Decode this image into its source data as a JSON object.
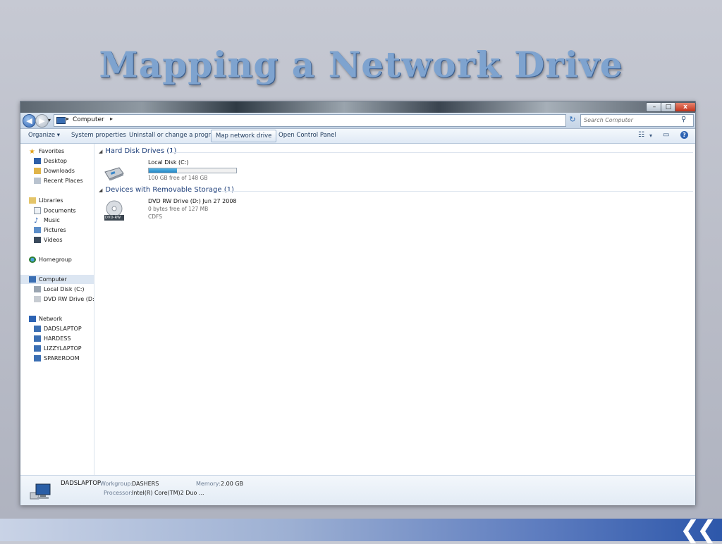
{
  "slide": {
    "title": "Mapping a Network Drive"
  },
  "window": {
    "controls": {
      "minimize": "–",
      "maximize": "□",
      "close": "x"
    }
  },
  "address": {
    "breadcrumb": "Computer",
    "search_placeholder": "Search Computer"
  },
  "toolbar": {
    "organize": "Organize ▾",
    "system_properties": "System properties",
    "uninstall": "Uninstall or change a program",
    "map_network_drive": "Map network drive",
    "open_control_panel": "Open Control Panel"
  },
  "nav": {
    "favorites": "Favorites",
    "desktop": "Desktop",
    "downloads": "Downloads",
    "recent_places": "Recent Places",
    "libraries": "Libraries",
    "documents": "Documents",
    "music": "Music",
    "pictures": "Pictures",
    "videos": "Videos",
    "homegroup": "Homegroup",
    "computer": "Computer",
    "local_disk": "Local Disk (C:)",
    "dvd_drive": "DVD RW Drive (D:) Ju",
    "network": "Network",
    "network_items": [
      "DADSLAPTOP",
      "HARDESS",
      "LIZZYLAPTOP",
      "SPAREROOM"
    ]
  },
  "content": {
    "hard_disk_group": "Hard Disk Drives (1)",
    "local_disk": {
      "name": "Local Disk (C:)",
      "free": "100 GB free of 148 GB",
      "used_fraction": 0.32
    },
    "removable_group": "Devices with Removable Storage (1)",
    "dvd": {
      "name": "DVD RW Drive (D:) Jun 27 2008",
      "free": "0 bytes free of 127 MB",
      "fs": "CDFS",
      "badge": "DVD-RW"
    }
  },
  "details": {
    "computer_name": "DADSLAPTOP",
    "workgroup_label": "Workgroup:",
    "workgroup": "DASHERS",
    "memory_label": "Memory:",
    "memory": "2.00 GB",
    "processor_label": "Processor:",
    "processor": "Intel(R) Core(TM)2 Duo ..."
  }
}
